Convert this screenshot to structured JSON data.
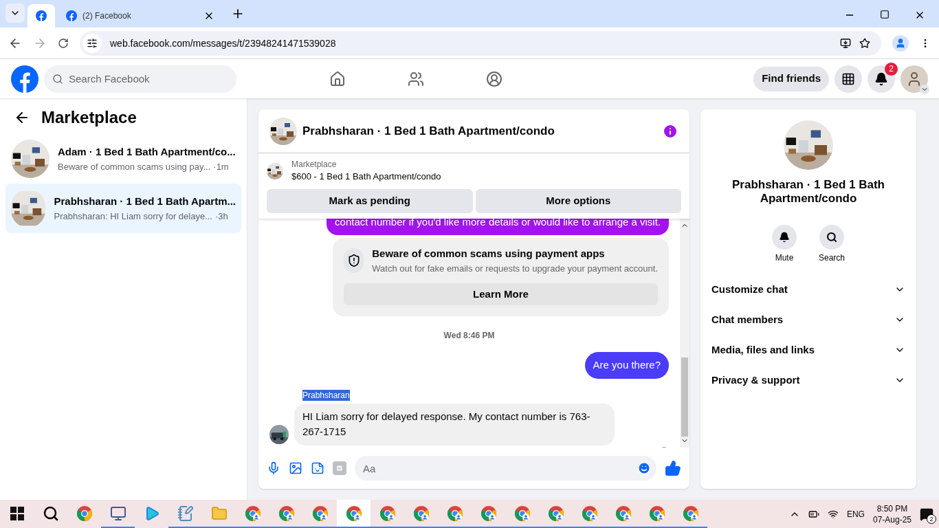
{
  "browser": {
    "tabs": [
      {
        "title": "(2) Facebook",
        "selected": false
      }
    ],
    "url": "web.facebook.com/messages/t/23948241471539028"
  },
  "header": {
    "search": {
      "placeholder": "Search Facebook"
    },
    "nav": [
      {
        "kind": "home"
      },
      {
        "kind": "friends"
      },
      {
        "kind": "groups"
      }
    ],
    "find_friends": "Find friends",
    "notifications": "2"
  },
  "sidebar": {
    "title": "Marketplace",
    "chats": [
      {
        "name": "Adam · 1 Bed 1 Bath Apartment/co...",
        "preview": "Beware of common scams using pay...",
        "time": "·1m",
        "selected": false
      },
      {
        "name": "Prabhsharan · 1 Bed 1 Bath Apartm...",
        "preview": "Prabhsharan: HI Liam sorry for delaye...",
        "time": "·3h",
        "selected": true
      }
    ]
  },
  "chat": {
    "title": "Prabhsharan · 1 Bed 1 Bath Apartment/condo",
    "listing": {
      "source": "Marketplace",
      "title": "$600 - 1 Bed 1 Bath Apartment/condo",
      "buttons": [
        "Mark as pending",
        "More options"
      ]
    },
    "messages": [
      {
        "kind": "outgoing",
        "color": "#a313f0",
        "text": "contact number if you'd like more details or would like to arrange a visit."
      },
      {
        "kind": "notice",
        "title": "Beware of common scams using payment apps",
        "text": "Watch out for fake emails or requests to upgrade your payment account.",
        "button": "Learn More"
      },
      {
        "kind": "timestamp",
        "text": "Wed 8:46 PM"
      },
      {
        "kind": "outgoing",
        "color": "#4a3cf7",
        "text": "Are you there?"
      },
      {
        "kind": "incoming",
        "sender": "Prabhsharan",
        "text": "HI Liam sorry for delayed response. My contact number is 763-267-1715"
      }
    ],
    "composer": {
      "placeholder": "Aa"
    }
  },
  "details": {
    "title": "Prabhsharan · 1 Bed 1 Bath Apartment/condo",
    "actions": [
      "Mute",
      "Search"
    ],
    "sections": [
      {
        "label": "Customize chat",
        "expanded": false
      },
      {
        "label": "Chat members",
        "expanded": false
      },
      {
        "label": "Media, files and links",
        "expanded": false
      },
      {
        "label": "Privacy & support",
        "expanded": false
      }
    ]
  },
  "taskbar": {
    "apps": [
      {
        "kind": "start",
        "open": false,
        "selected": false
      },
      {
        "kind": "search",
        "open": false,
        "selected": false
      },
      {
        "kind": "chrome",
        "open": false,
        "selected": false
      },
      {
        "kind": "app",
        "open": true,
        "selected": false
      },
      {
        "kind": "media",
        "open": false,
        "selected": false
      },
      {
        "kind": "notepad",
        "open": true,
        "selected": false
      },
      {
        "kind": "folder",
        "open": true,
        "selected": false
      },
      {
        "kind": "profile",
        "open": true,
        "selected": false
      },
      {
        "kind": "profile",
        "open": true,
        "selected": false
      },
      {
        "kind": "profile",
        "open": true,
        "selected": false
      },
      {
        "kind": "profile",
        "open": true,
        "selected": true
      },
      {
        "kind": "profile",
        "open": true,
        "selected": false
      },
      {
        "kind": "profile",
        "open": true,
        "selected": false
      },
      {
        "kind": "profile",
        "open": true,
        "selected": false
      },
      {
        "kind": "profile",
        "open": true,
        "selected": false
      },
      {
        "kind": "profile",
        "open": true,
        "selected": false
      },
      {
        "kind": "profile",
        "open": true,
        "selected": false
      },
      {
        "kind": "profile",
        "open": true,
        "selected": false
      },
      {
        "kind": "profile",
        "open": true,
        "selected": false
      },
      {
        "kind": "profile",
        "open": true,
        "selected": false
      },
      {
        "kind": "profile",
        "open": true,
        "selected": false
      }
    ],
    "language": "ENG",
    "time": "8:50 PM",
    "date": "07-Aug-25",
    "notifications": "2"
  }
}
